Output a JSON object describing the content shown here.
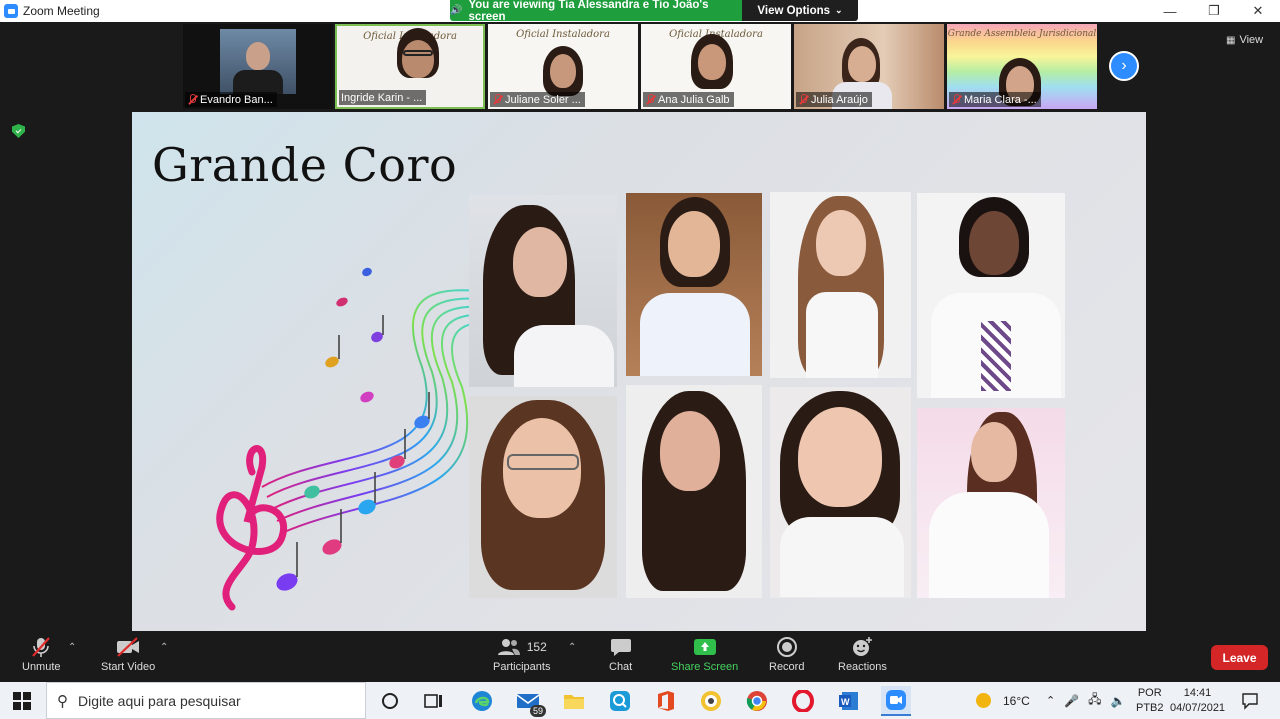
{
  "window": {
    "title": "Zoom Meeting"
  },
  "share_banner": {
    "text": "You are viewing Tia Alessandra e Tio João's screen",
    "view_options": "View Options"
  },
  "gallery": {
    "participants": [
      {
        "name": "Evandro Ban..."
      },
      {
        "name": "Ingride Karin - ..."
      },
      {
        "name": "Juliane Soler ..."
      },
      {
        "name": "Ana Julia Galb"
      },
      {
        "name": "Julia Araújo"
      },
      {
        "name": "Maria Clara -..."
      }
    ],
    "view_label": "View"
  },
  "slide": {
    "title": "Grande Coro"
  },
  "toolbar": {
    "unmute": "Unmute",
    "start_video": "Start Video",
    "participants": "Participants",
    "participants_count": "152",
    "chat": "Chat",
    "share_screen": "Share Screen",
    "record": "Record",
    "reactions": "Reactions",
    "leave": "Leave"
  },
  "taskbar": {
    "search_placeholder": "Digite aqui para pesquisar",
    "mail_badge": "59",
    "weather": "16°C",
    "lang_top": "POR",
    "lang_bottom": "PTB2",
    "time": "14:41",
    "date": "04/07/2021"
  },
  "colors": {
    "zoom_blue": "#2d8cff",
    "share_green": "#1e9e3c",
    "leave_red": "#d42626"
  }
}
